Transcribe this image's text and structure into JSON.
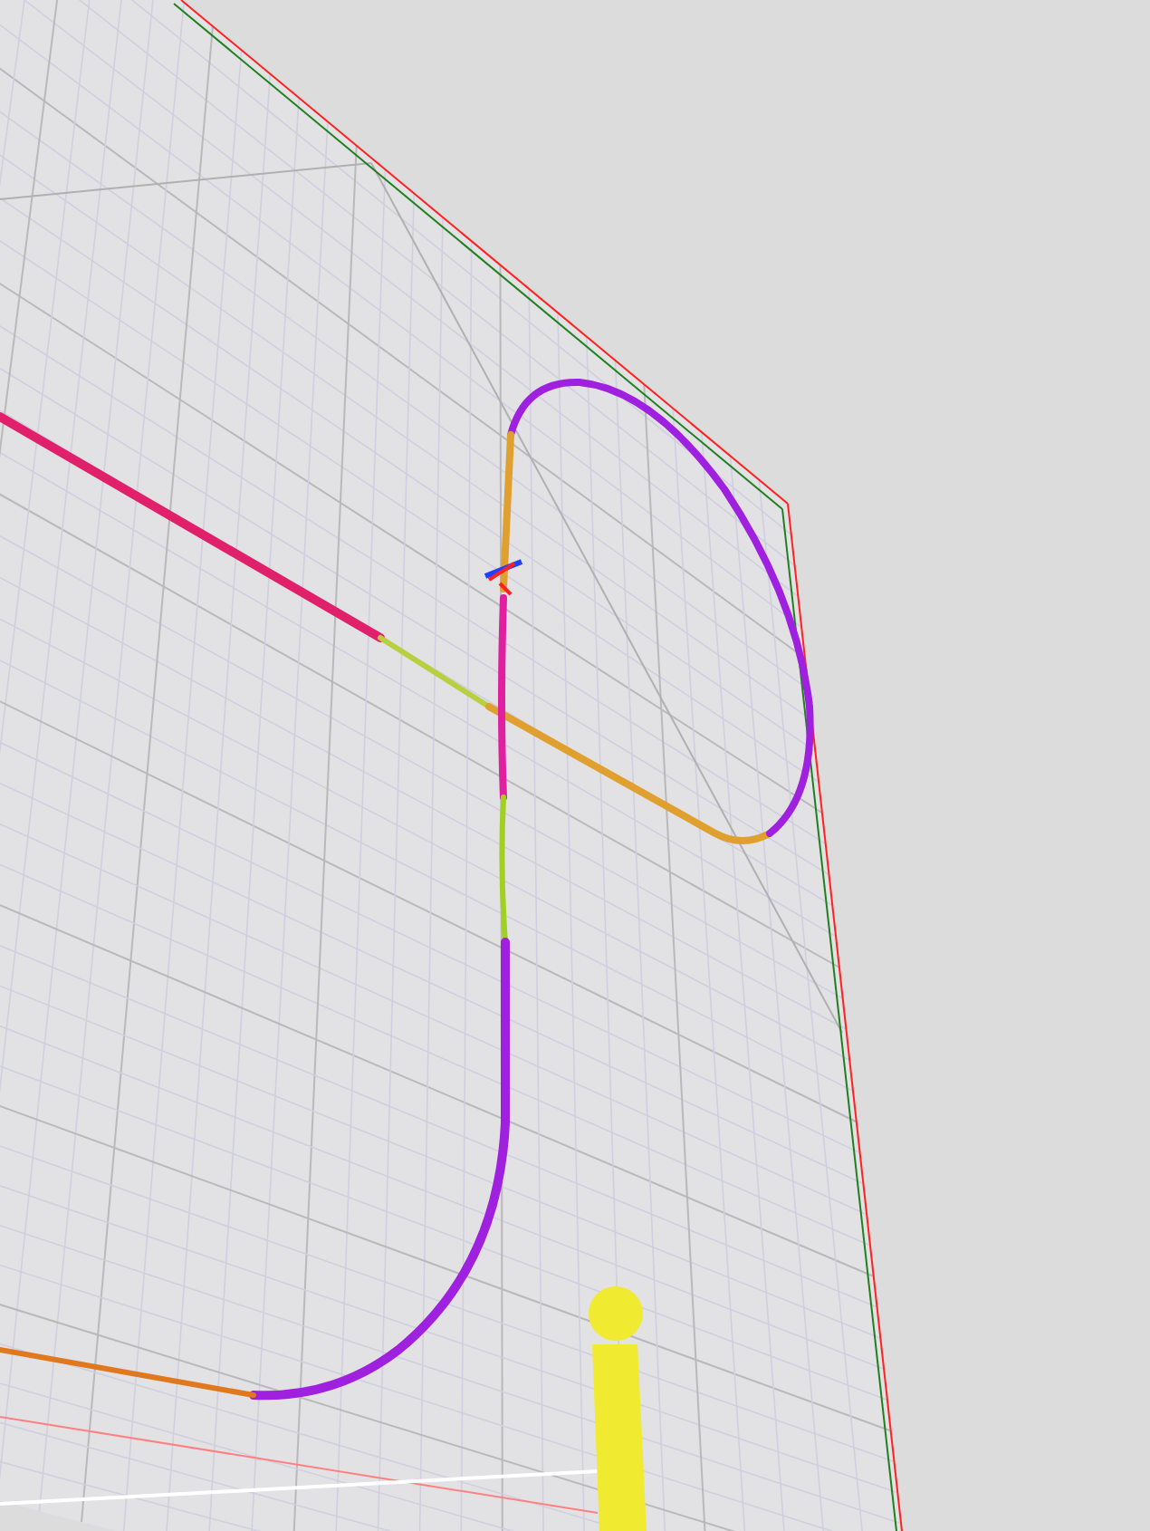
{
  "viewport": {
    "grid": true,
    "pole": true
  }
}
